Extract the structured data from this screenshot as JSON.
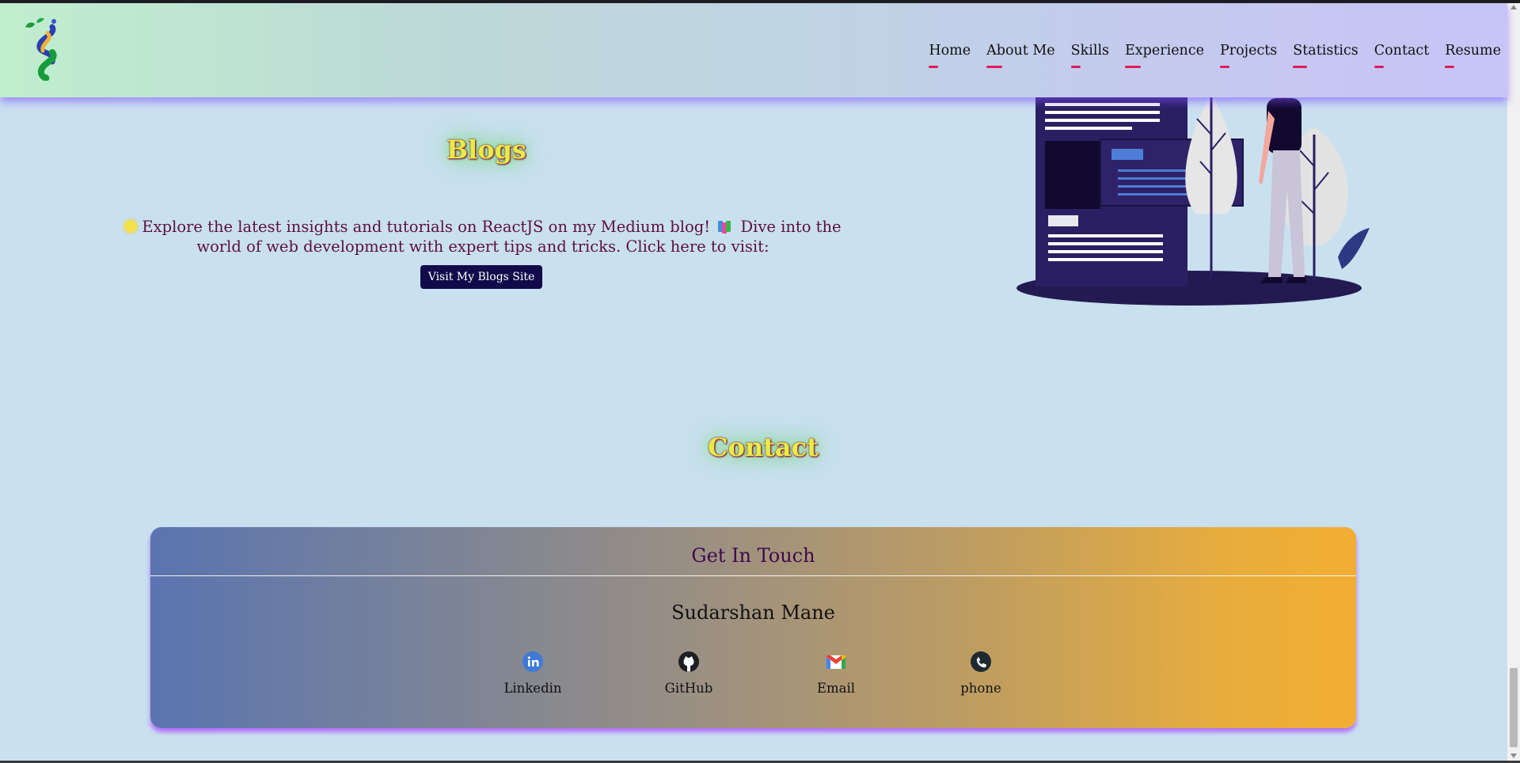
{
  "nav": {
    "links": [
      "Home",
      "About Me",
      "Skills",
      "Experience",
      "Projects",
      "Statistics",
      "Contact",
      "Resume"
    ]
  },
  "blogs": {
    "title": "Blogs",
    "text_part1": "Explore the latest insights and tutorials on ReactJS on my Medium blog!",
    "text_part2": "Dive into the world of web development with expert tips and tricks. Click here to visit:",
    "button_label": "Visit My Blogs Site"
  },
  "contact": {
    "title": "Contact",
    "card_title": "Get In Touch",
    "name": "Sudarshan Mane",
    "items": [
      {
        "label": "Linkedin",
        "icon": "linkedin-icon"
      },
      {
        "label": "GitHub",
        "icon": "github-icon"
      },
      {
        "label": "Email",
        "icon": "gmail-icon"
      },
      {
        "label": "phone",
        "icon": "phone-icon"
      }
    ]
  },
  "colors": {
    "accent_underline": "#e21a57",
    "button_bg": "#120b4a",
    "title_yellow": "#e8ec46"
  }
}
